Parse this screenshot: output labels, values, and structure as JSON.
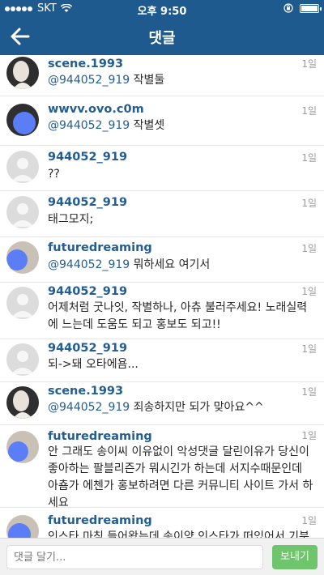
{
  "status_bar": {
    "carrier": "SKT",
    "time": "오후 9:50"
  },
  "header": {
    "title": "댓글"
  },
  "comments": [
    {
      "username": "scene.1993",
      "mention": "@944052_919",
      "text": " 작별둘",
      "time": "1일"
    },
    {
      "username": "wwvv.ovo.c0m",
      "mention": "@944052_919",
      "text": " 작별셋",
      "time": "1일"
    },
    {
      "username": "944052_919",
      "mention": "",
      "text": "??",
      "time": "1일"
    },
    {
      "username": "944052_919",
      "mention": "",
      "text": "태그모지;",
      "time": "1일"
    },
    {
      "username": "futuredreaming",
      "mention": "@944052_919",
      "text": "  뭐하세요 여기서",
      "time": "1일"
    },
    {
      "username": "944052_919",
      "mention": "",
      "text": "어제처럼 굿나잇, 작별하나, 아츄 불러주세요! 노래실력에 느는데 도움도 되고 홍보도 되고!!",
      "time": "1일"
    },
    {
      "username": "944052_919",
      "mention": "",
      "text": "되->돼 오타에욤...",
      "time": "1일"
    },
    {
      "username": "scene.1993",
      "mention": "@944052_919",
      "text": " 죄송하지만 되가 맞아요^^",
      "time": "1일"
    },
    {
      "username": "futuredreaming",
      "mention": "",
      "text": "안 그래도 송이씨 이유없이 악성댓글 달린이유가 당신이 좋아하는 팔블리즌가 뭐시긴가 하는데 서지수때문인데 아춈가 에첸가 홍보하려면 다른 커뮤니티 사이트 가서 하세요",
      "time": "1일"
    },
    {
      "username": "futuredreaming",
      "mention": "",
      "text": "인스타 마침 들어왔는데 송이양 인스타가 떠있어서 기분",
      "time": "1일"
    }
  ],
  "composer": {
    "placeholder": "댓글 달기...",
    "send_label": "보내기"
  }
}
